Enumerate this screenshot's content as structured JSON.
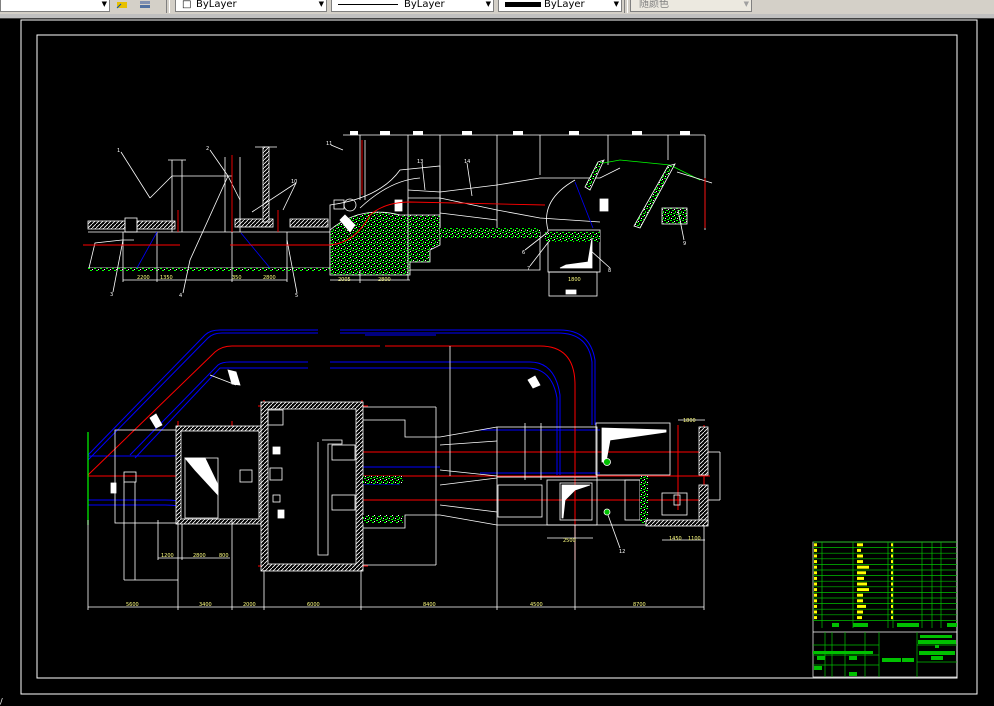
{
  "toolbar": {
    "layer_value": "ByLayer",
    "linetype_value": "ByLayer",
    "lineweight_value": "ByLayer",
    "plotstyle_value": "随颜色",
    "icons": [
      "layer-manager-icon",
      "layer-states-icon"
    ]
  },
  "colors": {
    "background": "#000000",
    "frame": "#ffffff",
    "pipe_blue": "#0000ff",
    "centerline_red": "#ff0000",
    "concrete_green": "#00ff00",
    "titleblock_green": "#00c000",
    "text_yellow": "#ffff00"
  },
  "elevation": {
    "callouts": [
      "1",
      "2",
      "10",
      "11",
      "3",
      "4",
      "5",
      "13",
      "14",
      "6",
      "7",
      "8",
      "9"
    ],
    "dimensions": [
      "2200",
      "1350",
      "350",
      "2800",
      "2005",
      "2800",
      "1800"
    ]
  },
  "plan": {
    "callouts": [
      "12"
    ],
    "dimensions": [
      "5600",
      "3400",
      "2000",
      "6000",
      "8400",
      "4500",
      "8700",
      "1200",
      "2800",
      "800",
      "2500",
      "1800",
      "1450",
      "1100"
    ]
  },
  "status": {
    "command_line": "/"
  }
}
